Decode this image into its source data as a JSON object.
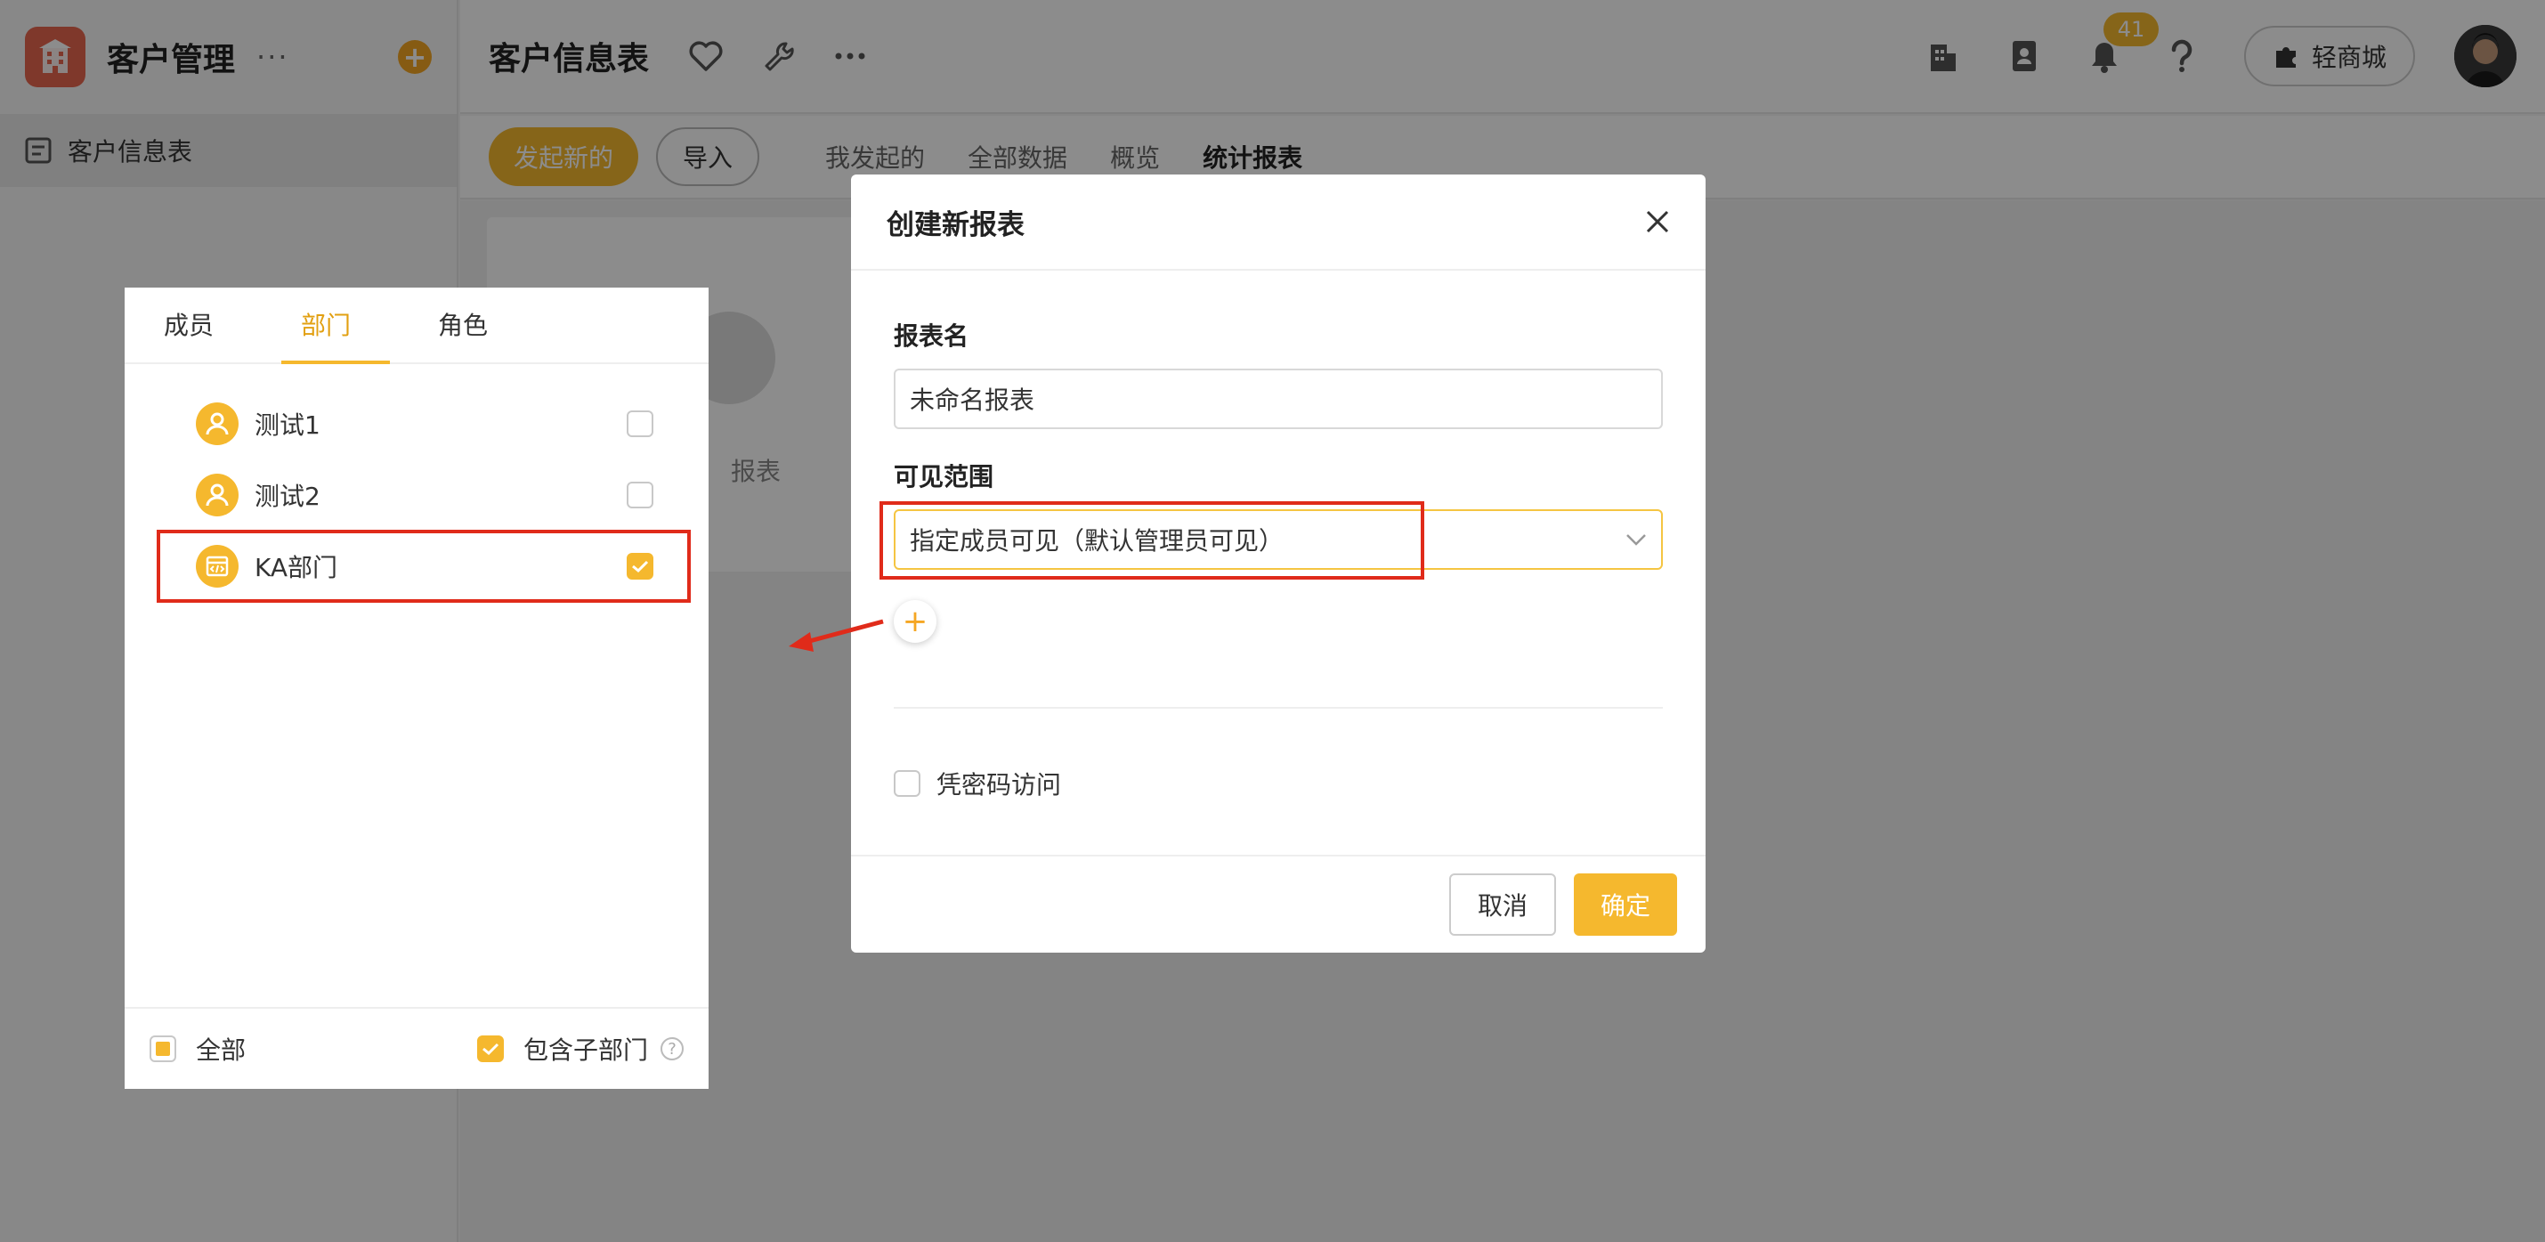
{
  "app": {
    "name": "客户管理",
    "more": "···"
  },
  "sidebar": {
    "items": [
      {
        "label": "客户信息表"
      }
    ]
  },
  "topbar": {
    "title": "客户信息表",
    "notification_count": "41",
    "mall_label": "轻商城"
  },
  "toolbar": {
    "launch_label": "发起新的",
    "import_label": "导入",
    "tabs": [
      {
        "label": "我发起的"
      },
      {
        "label": "全部数据"
      },
      {
        "label": "概览"
      },
      {
        "label": "统计报表",
        "active": true
      }
    ]
  },
  "content": {
    "card_label": "报表"
  },
  "picker": {
    "tabs": [
      {
        "label": "成员"
      },
      {
        "label": "部门",
        "active": true
      },
      {
        "label": "角色"
      }
    ],
    "departments": [
      {
        "name": "测试1",
        "checked": false
      },
      {
        "name": "测试2",
        "checked": false
      },
      {
        "name": "KA部门",
        "checked": true
      }
    ],
    "footer": {
      "all_label": "全部",
      "include_sub_label": "包含子部门",
      "help": "?"
    }
  },
  "dialog": {
    "title": "创建新报表",
    "name_label": "报表名",
    "name_value": "未命名报表",
    "scope_label": "可见范围",
    "scope_value": "指定成员可见（默认管理员可见）",
    "add_symbol": "+",
    "password_label": "凭密码访问",
    "cancel_label": "取消",
    "ok_label": "确定"
  },
  "colors": {
    "accent": "#f5b82e",
    "highlight": "#e02b1a"
  }
}
